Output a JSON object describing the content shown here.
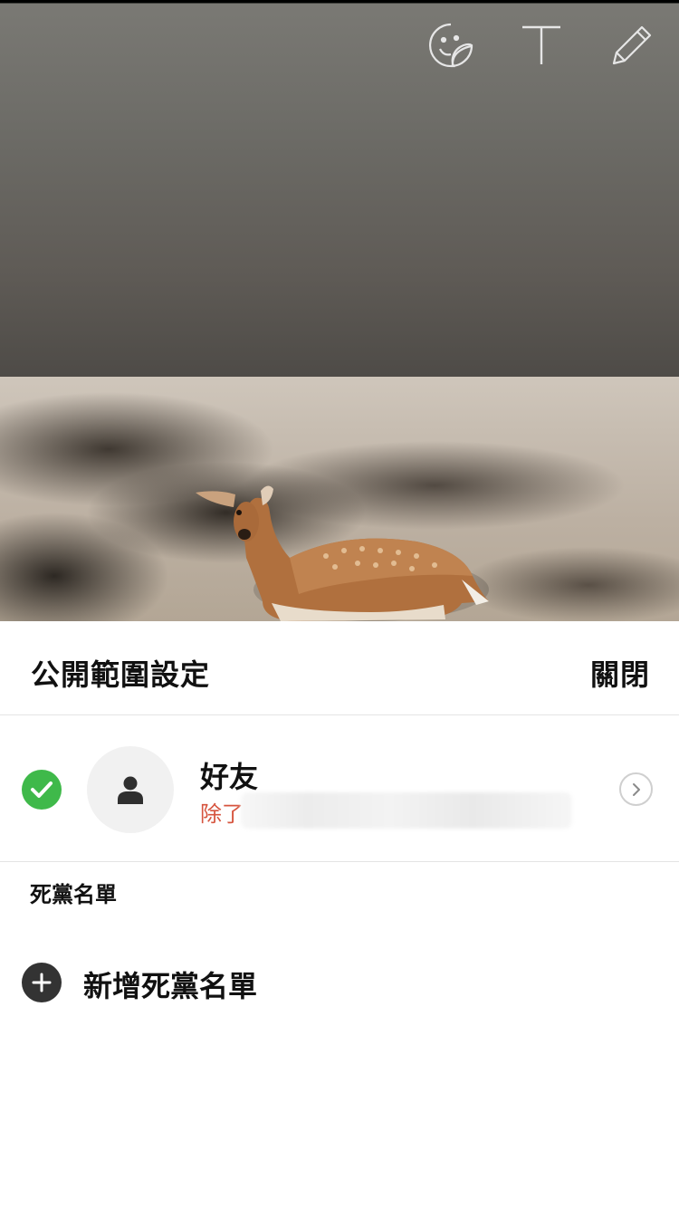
{
  "toolbar": {
    "icons": [
      "sticker-icon",
      "text-icon",
      "pencil-icon"
    ]
  },
  "sheet": {
    "title": "公開範圍設定",
    "close_label": "關閉"
  },
  "audience": {
    "label": "好友",
    "sub_prefix": "除了",
    "selected": true
  },
  "blacklist": {
    "section_label": "死黨名單",
    "add_label": "新增死黨名單"
  },
  "colors": {
    "check": "#3fb94a",
    "sub_text": "#d6543e"
  }
}
